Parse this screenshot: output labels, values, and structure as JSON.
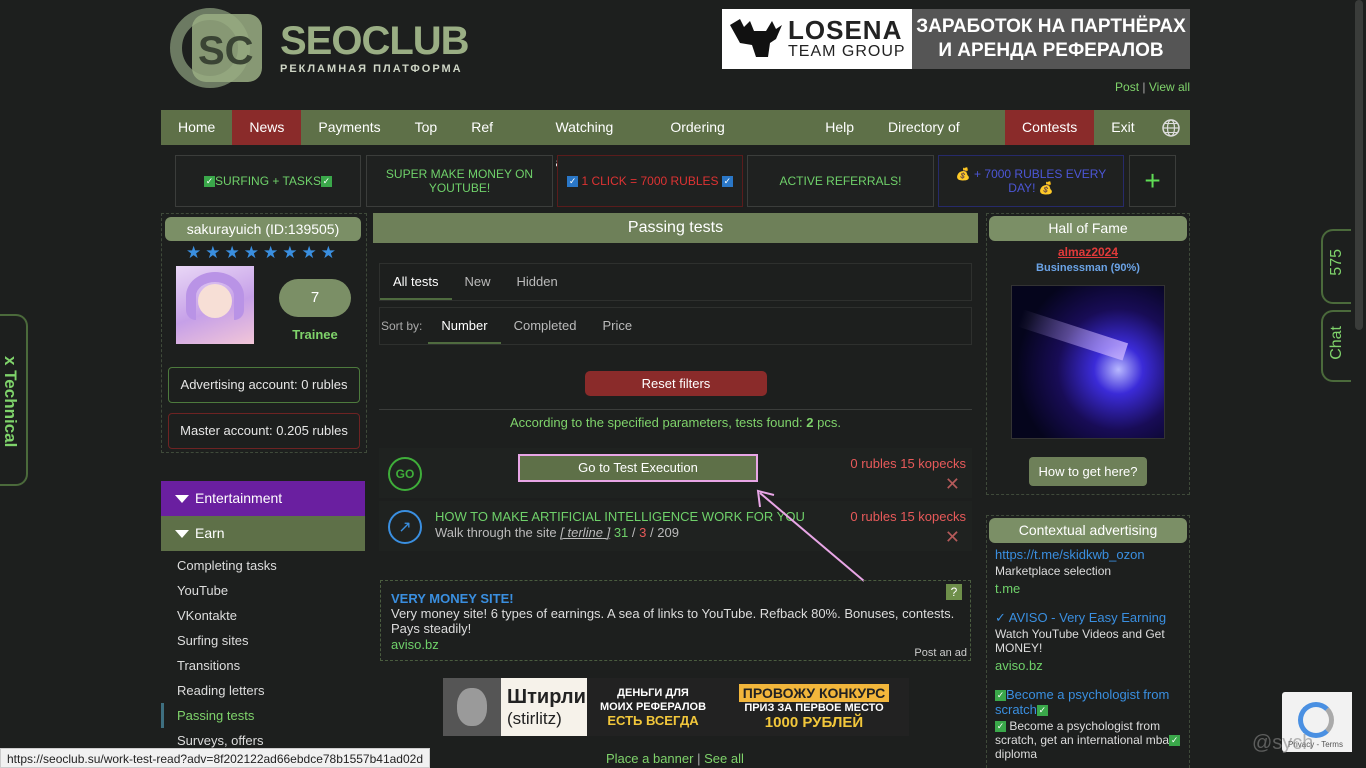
{
  "header": {
    "logo_title": "SEOCLUB",
    "logo_subtitle": "РЕКЛАМНАЯ ПЛАТФОРМА",
    "banner_brand": "LOSENA",
    "banner_brand_sub": "TEAM GROUP",
    "banner_text_1": "ЗАРАБОТОК НА ПАРТНЁРАХ",
    "banner_text_2": "И АРЕНДА РЕФЕРАЛОВ",
    "post_link": "Post",
    "separator": "|",
    "view_all_link": "View all"
  },
  "nav": {
    "items": [
      "Home",
      "News",
      "Payments",
      "Top",
      "Ref Wall",
      "Watching ads",
      "Ordering advertising",
      "Help",
      "Directory of sites",
      "Contests",
      "Exit"
    ],
    "globe_icon": "globe-icon"
  },
  "promos": [
    "SURFING + TASKS",
    "SUPER MAKE MONEY ON YOUTUBE!",
    "1 CLICK = 7000 RUBLES",
    "ACTIVE REFERRALS!",
    "+ 7000 RUBLES EVERY DAY!"
  ],
  "promo_plus": "+",
  "user": {
    "name": "sakurayuich (ID:139505)",
    "stars": 8,
    "level": "7",
    "rank": "Trainee",
    "advertising_account": "Advertising account: 0 rubles",
    "master_account": "Master account: 0.205 rubles"
  },
  "menu": {
    "entertainment": "Entertainment",
    "earn": "Earn",
    "items": [
      "Completing tasks",
      "YouTube",
      "VKontakte",
      "Surfing sites",
      "Transitions",
      "Reading letters",
      "Passing tests",
      "Surveys, offers"
    ]
  },
  "main": {
    "title": "Passing tests",
    "tabs": [
      "All tests",
      "New",
      "Hidden"
    ],
    "sort_label": "Sort by:",
    "sort_options": [
      "Number",
      "Completed",
      "Price"
    ],
    "reset_label": "Reset filters",
    "found_text": "According to the specified parameters, tests found: ",
    "found_count": "2",
    "found_unit": " pcs.",
    "tests": [
      {
        "button": "Go to Test Execution",
        "price": "0 rubles 15 kopecks",
        "icon": "GO"
      },
      {
        "title": "HOW TO MAKE ARTIFICIAL INTELLIGENCE WORK FOR YOU",
        "sub_prefix": "Walk through the site",
        "sub_bracket_open": "[",
        "sub_user": "terline",
        "sub_bracket_close": "]",
        "n1": "31",
        "slash": "/",
        "n2": "3",
        "n3": "209",
        "price": "0 rubles 15 kopecks"
      }
    ]
  },
  "ad": {
    "title": "VERY MONEY SITE!",
    "text": "Very money site! 6 types of earnings. A sea of links to YouTube. Refback 80%. Bonuses, contests. Pays steadily!",
    "url": "aviso.bz",
    "help": "?",
    "post": "Post an ad"
  },
  "bottom_banner": {
    "name_ru": "Штирлиц",
    "name_en": "(stirlitz)",
    "mid_1": "ДЕНЬГИ ДЛЯ",
    "mid_2": "МОИХ РЕФЕРАЛОВ",
    "mid_3": "ЕСТЬ ВСЕГДА",
    "r_1": "ПРОВОЖУ КОНКУРС",
    "r_2": "ПРИЗ ЗА ПЕРВОЕ МЕСТО",
    "r_3": "1000 РУБЛЕЙ"
  },
  "place_banner": "Place a banner",
  "see_all": "See all",
  "hall": {
    "title": "Hall of Fame",
    "user": "almaz2024",
    "status": "Businessman (90%)",
    "how": "How to get here?"
  },
  "context": {
    "title": "Contextual advertising",
    "items": [
      {
        "link": "https://t.me/skidkwb_ozon",
        "desc": "Marketplace selection",
        "url": "t.me"
      },
      {
        "link": "✓ AVISO - Very Easy Earning",
        "desc": "Watch YouTube Videos and Get MONEY!",
        "url": "aviso.bz"
      },
      {
        "link": "Become a psychologist from scratch",
        "desc": "Become a psychologist from scratch, get an international mba",
        "desc_tail": "diploma"
      }
    ]
  },
  "side": {
    "technical": "x Technical",
    "count": "575",
    "chat": "Chat"
  },
  "recaptcha": "Privacy - Terms",
  "watermark": "@sych",
  "status_url": "https://seoclub.su/work-test-read?adv=8f202122ad66ebdce78b1557b41ad02d"
}
